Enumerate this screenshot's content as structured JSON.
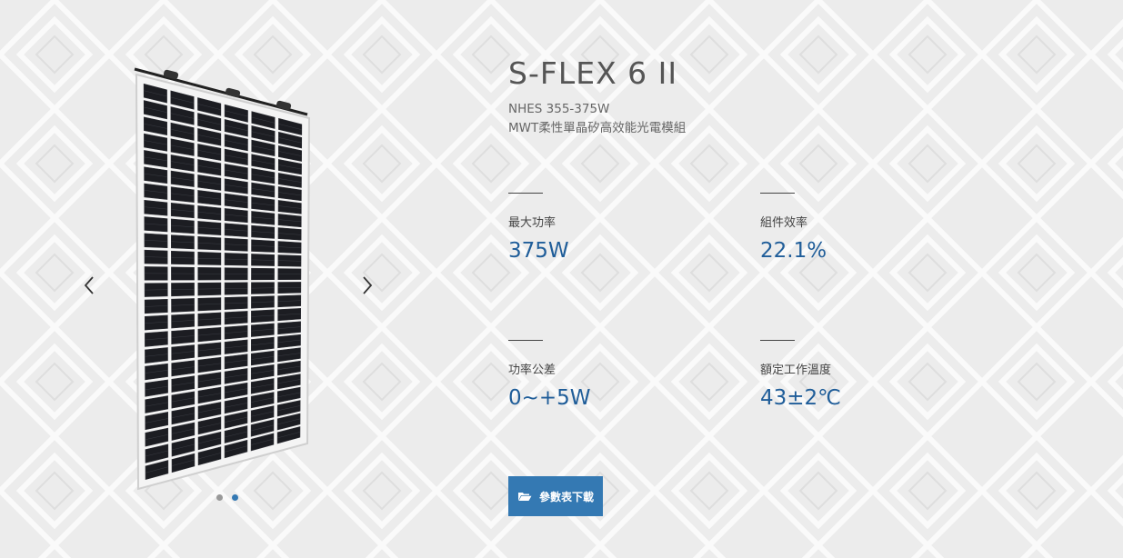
{
  "product": {
    "title": "S-FLEX 6 II",
    "model": "NHES 355-375W",
    "subtitle": "MWT柔性單晶矽高效能光電模組"
  },
  "specs": [
    {
      "label": "最大功率",
      "value": "375W"
    },
    {
      "label": "組件效率",
      "value": "22.1%"
    },
    {
      "label": "功率公差",
      "value": "0~+5W"
    },
    {
      "label": "額定工作溫度",
      "value": "43±2℃"
    }
  ],
  "download": {
    "label": "參數表下載",
    "icon": "folder-open-icon"
  },
  "carousel": {
    "prev_icon": "chevron-left-icon",
    "next_icon": "chevron-right-icon",
    "slide_count": 2,
    "active_slide": 2
  },
  "colors": {
    "accent": "#3479b3",
    "value_text": "#1f5d99",
    "background": "#ececec"
  }
}
